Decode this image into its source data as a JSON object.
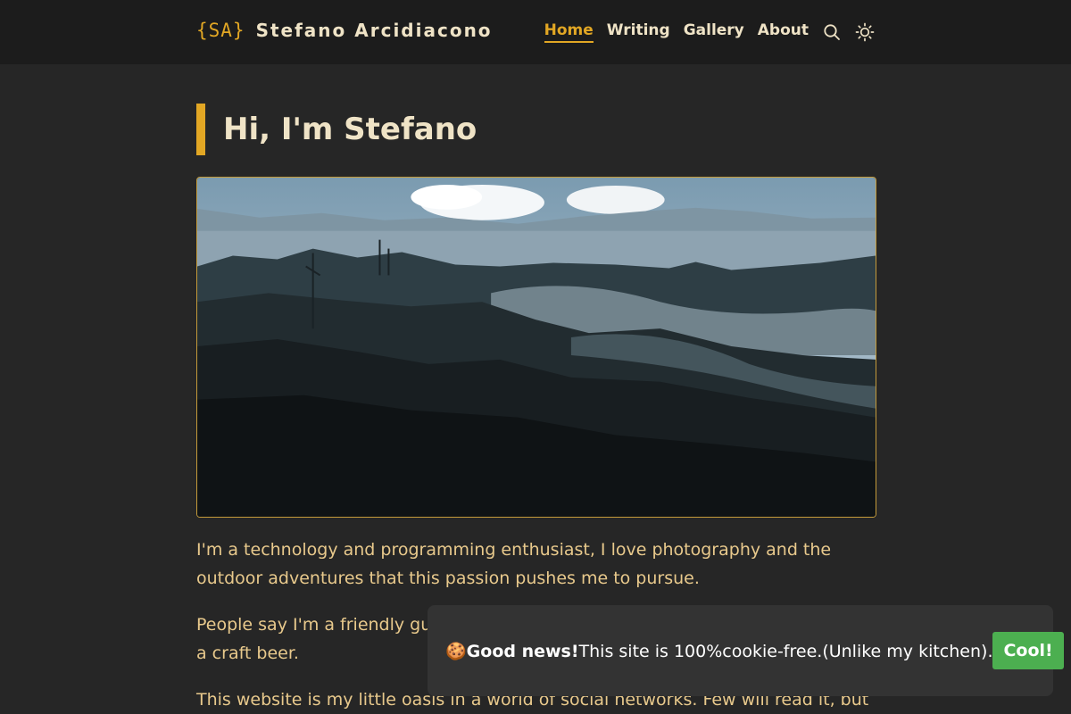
{
  "header": {
    "logo_mark": "{SA}",
    "site_name": "Stefano Arcidiacono",
    "nav": {
      "home": "Home",
      "writing": "Writing",
      "gallery": "Gallery",
      "about": "About"
    },
    "icons": {
      "search": "search-icon",
      "theme": "sun-icon"
    }
  },
  "main": {
    "title": "Hi, I'm Stefano",
    "paragraphs": [
      "I'm a technology and programming enthusiast, I love photography and the outdoor adventures that this passion pushes me to pursue.",
      "People say I'm a friendly guy, always up for a chat over a good Sicilian wine or a craft beer.",
      "This website is my little oasis in a world of social networks. Few will read it, but"
    ]
  },
  "cookie": {
    "emoji": "🍪",
    "strong": "Good news!",
    "message": "This site is 100%cookie-free.(Unlike my kitchen).",
    "button": "Cool!"
  },
  "colors": {
    "accent": "#e2a724",
    "text": "#e8c98c",
    "heading": "#efe3c6",
    "background": "#262626",
    "header_bg": "#1c1c1c",
    "cookie_bg": "#333333",
    "cookie_button": "#4caf50"
  }
}
